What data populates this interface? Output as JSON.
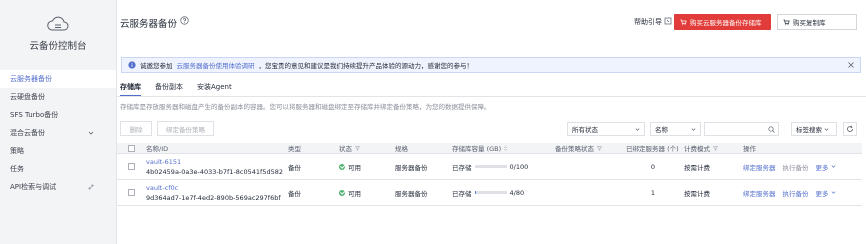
{
  "sidebar": {
    "title": "云备份控制台",
    "items": [
      {
        "label": "云服务器备份",
        "active": true,
        "expandable": false
      },
      {
        "label": "云硬盘备份",
        "active": false,
        "expandable": false
      },
      {
        "label": "SFS Turbo备份",
        "active": false,
        "expandable": false
      },
      {
        "label": "混合云备份",
        "active": false,
        "expandable": true
      },
      {
        "label": "策略",
        "active": false,
        "expandable": false
      },
      {
        "label": "任务",
        "active": false,
        "expandable": false
      },
      {
        "label": "API检索与调试",
        "active": false,
        "expandable": false,
        "icon": "link-icon"
      }
    ]
  },
  "header": {
    "title": "云服务器备份",
    "help_link": "帮助引导",
    "buy_button": "购买云服务器备份存储库",
    "buy_dup_button": "购买复制库"
  },
  "notice": {
    "prefix": "诚邀您参加",
    "link": "云服务器备份使用体验调研",
    "suffix": "，您宝贵的意见和建议是我们持续提升产品体验的源动力，感谢您的参与！"
  },
  "tabs": [
    {
      "label": "存储库",
      "active": true
    },
    {
      "label": "备份副本",
      "active": false
    },
    {
      "label": "安装Agent",
      "active": false
    }
  ],
  "description": "存储库是存放服务器和磁盘产生的备份副本的容器。您可以将服务器和磁盘绑定至存储库并绑定备份策略，为您的数据提供保障。",
  "toolbar": {
    "delete_button": "删除",
    "bind_policy_button": "绑定备份策略",
    "status_filter": "所有状态",
    "search_field": "名称",
    "tag_search": "标签搜索"
  },
  "table": {
    "headers": {
      "name": "名称/ID",
      "type": "类型",
      "status": "状态",
      "spec": "规格",
      "capacity": "存储库容量 (GB)",
      "policy": "备份策略状态",
      "bound": "已绑定服务器 (个)",
      "billing": "计费模式",
      "ops": "操作"
    },
    "rows": [
      {
        "name": "vault-6151",
        "id": "4b02459a-0a3e-4033-b7f1-8c0541f5d582",
        "type": "备份",
        "status": "可用",
        "spec": "服务器备份",
        "capacity_label": "已存储",
        "capacity_used": 0,
        "capacity_total": 100,
        "capacity_text": "0/100",
        "policy": "",
        "bound": "0",
        "billing": "按需计费",
        "ops": [
          "绑定服务器",
          "执行备份",
          "更多"
        ]
      },
      {
        "name": "vault-cf0c",
        "id": "9d364ad7-1e7f-4ed2-890b-569ac297f6bf",
        "type": "备份",
        "status": "可用",
        "spec": "服务器备份",
        "capacity_label": "已存储",
        "capacity_used": 4,
        "capacity_total": 80,
        "capacity_text": "4/80",
        "policy": "",
        "bound": "1",
        "billing": "按需计费",
        "ops": [
          "绑定服务器",
          "执行备份",
          "更多"
        ]
      }
    ]
  },
  "colors": {
    "accent": "#526ecc",
    "buy_button": "#e13c39",
    "status_ok": "#50b371"
  }
}
